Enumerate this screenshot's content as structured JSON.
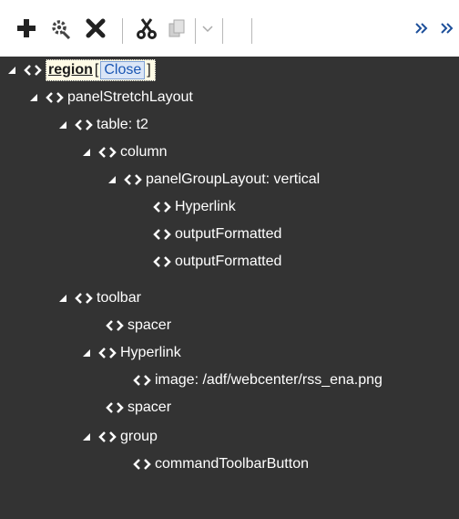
{
  "toolbar": {
    "icons": [
      "plus-icon",
      "gear-icon",
      "close-icon",
      "cut-icon",
      "copy-icon",
      "chevron-down-icon",
      "double-chevron-right-icon"
    ]
  },
  "tree": {
    "root": {
      "label": "region",
      "bracket_open": "[",
      "close_label": "Close",
      "bracket_close": "]"
    },
    "nodes": [
      {
        "label": "panelStretchLayout"
      },
      {
        "label": "table: t2"
      },
      {
        "label": "column"
      },
      {
        "label": "panelGroupLayout: vertical"
      },
      {
        "label": "Hyperlink"
      },
      {
        "label": "outputFormatted"
      },
      {
        "label": "outputFormatted"
      },
      {
        "label": "toolbar"
      },
      {
        "label": "spacer"
      },
      {
        "label": "Hyperlink"
      },
      {
        "label": "image: /adf/webcenter/rss_ena.png"
      },
      {
        "label": "spacer"
      },
      {
        "label": "group"
      },
      {
        "label": "commandToolbarButton"
      }
    ]
  },
  "colors": {
    "panel_bg": "#333333",
    "text": "#ffffff",
    "root_highlight": "#fffbe6",
    "link": "#1a56b3"
  }
}
